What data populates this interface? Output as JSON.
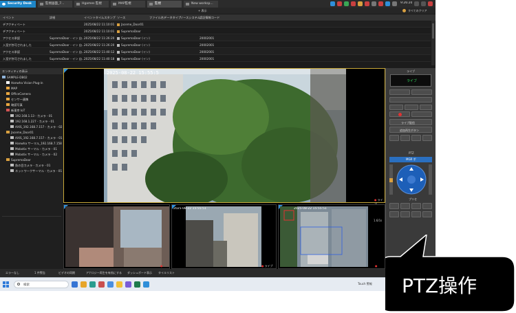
{
  "tabs": [
    {
      "label": "Security Desk"
    },
    {
      "label": "監視画面_7..."
    },
    {
      "label": "Hgames 監視"
    },
    {
      "label": "MAP監視"
    },
    {
      "label": "監視"
    },
    {
      "label": "New worksp..."
    }
  ],
  "tray_time": "9:26:20",
  "event_panel": {
    "toolbar_btn": "+ 表示",
    "toolbar_right": "すべてのクリア",
    "columns": [
      "イベント",
      "詳細",
      "イベントタイムスタンプ",
      "ソース",
      "ファイル名",
      "データタイプ",
      "ソースシステム",
      "認証情報コード"
    ],
    "rows": [
      {
        "event": "デアクティベート",
        "detail": "",
        "timestamp": "2025/08/22 11:10:01",
        "source": "Jaceme_Door01",
        "code": ""
      },
      {
        "event": "デアクティベート",
        "detail": "",
        "timestamp": "2025/08/22 11:10:01",
        "source": "SupremaDoor",
        "code": ""
      },
      {
        "event": "アクセス承認",
        "detail": "SupremaDoor - イン 自...",
        "timestamp": "2025/08/22 11:26:20",
        "source": "SupremaDoor (イン)",
        "code": "20002001"
      },
      {
        "event": "入室が許可されました",
        "detail": "SupremaDoor - イン 自...",
        "timestamp": "2025/08/22 11:26:20",
        "source": "SupremaDoor (イン)",
        "code": "20002001"
      },
      {
        "event": "アクセス承認",
        "detail": "SupremaDoor - イン 自...",
        "timestamp": "2025/08/22 11:40:12",
        "source": "SupremaDoor (イン)",
        "code": "20002001"
      },
      {
        "event": "入室が許可されました",
        "detail": "SupremaDoor - イン 自...",
        "timestamp": "2025/08/22 11:40:18",
        "source": "SupremaDoor (イン)",
        "code": "20002001"
      }
    ]
  },
  "tree": {
    "title": "エンティティの表示",
    "items": [
      {
        "label": "SAMPLE-DB02",
        "color": "#8fb3d9"
      },
      {
        "label": "Hanwha Vision Plug-in",
        "color": "#ffffff"
      },
      {
        "label": "MAP",
        "color": "#e8a640"
      },
      {
        "label": "OfficeCamera",
        "color": "#e8a640"
      },
      {
        "label": "センサー連携",
        "color": "#e8a640"
      },
      {
        "label": "確認写真",
        "color": "#e8a640"
      },
      {
        "label": "新東京 IoT",
        "color": "#d35454"
      },
      {
        "label": "192.168.1.13 - カメラ - 01",
        "color": "#bfbfbf"
      },
      {
        "label": "192.168.1.227 - カメラ - 01",
        "color": "#bfbfbf"
      },
      {
        "label": "AXIS_192.168.7.157 - カメラ - 02",
        "color": "#bfbfbf"
      },
      {
        "label": "Jaceme_Door01",
        "color": "#d9a040"
      },
      {
        "label": "AXIS_192.168.7.157 - カメラ - 01",
        "color": "#bfbfbf"
      },
      {
        "label": "Hanwha サーマル_192.168.7.158",
        "color": "#bfbfbf"
      },
      {
        "label": "Mobotix サーマル - カメラ - 01",
        "color": "#bfbfbf"
      },
      {
        "label": "Mobotix サーマル - カメラ - 02",
        "color": "#bfbfbf"
      },
      {
        "label": "SupremaDoor",
        "color": "#d9a040"
      },
      {
        "label": "魚の目カメラ - カメラ - 01",
        "color": "#bfbfbf"
      },
      {
        "label": "ネットワークサーマル - カメラ - 01",
        "color": "#bfbfbf"
      }
    ]
  },
  "video": {
    "main_timestamp": "2025-08-22 15:55:5",
    "live_label": "ライブ",
    "tile3_timestamp": "2025-08-22 15:55:51",
    "tile4_timestamp": "2025-08-22 15:55:51",
    "mini_label": "1.6/1s"
  },
  "ptz": {
    "title": "ライブ",
    "live_display": "ライブ",
    "live_toggle": "ライブ配信",
    "record_btn": "追加再生ボタン",
    "section": "PTZ",
    "mode": "MGR ポ",
    "preset_label": "プリセ"
  },
  "statusbar": [
    "エラーなし",
    "1 件警告",
    "ビデオの同期",
    "アナロジー再生を有効にする",
    "ダッシュボード表示",
    "タイルリスト"
  ],
  "taskbar": {
    "search_placeholder": "検索",
    "weather": "",
    "right_label": "Touch 警報",
    "app_colors": [
      "#3574d4",
      "#e7a52a",
      "#2a9d8f",
      "#c94f4f",
      "#4a8fe0",
      "#f2c037",
      "#7b5cd6",
      "#1f7a4c",
      "#2f8fd9"
    ]
  },
  "callout": {
    "label": "PTZ操作",
    "bg": "#000000"
  },
  "colors": {
    "accent": "#2f8fd9",
    "live_red": "#e23232",
    "frame_yellow": "#c8a838"
  }
}
